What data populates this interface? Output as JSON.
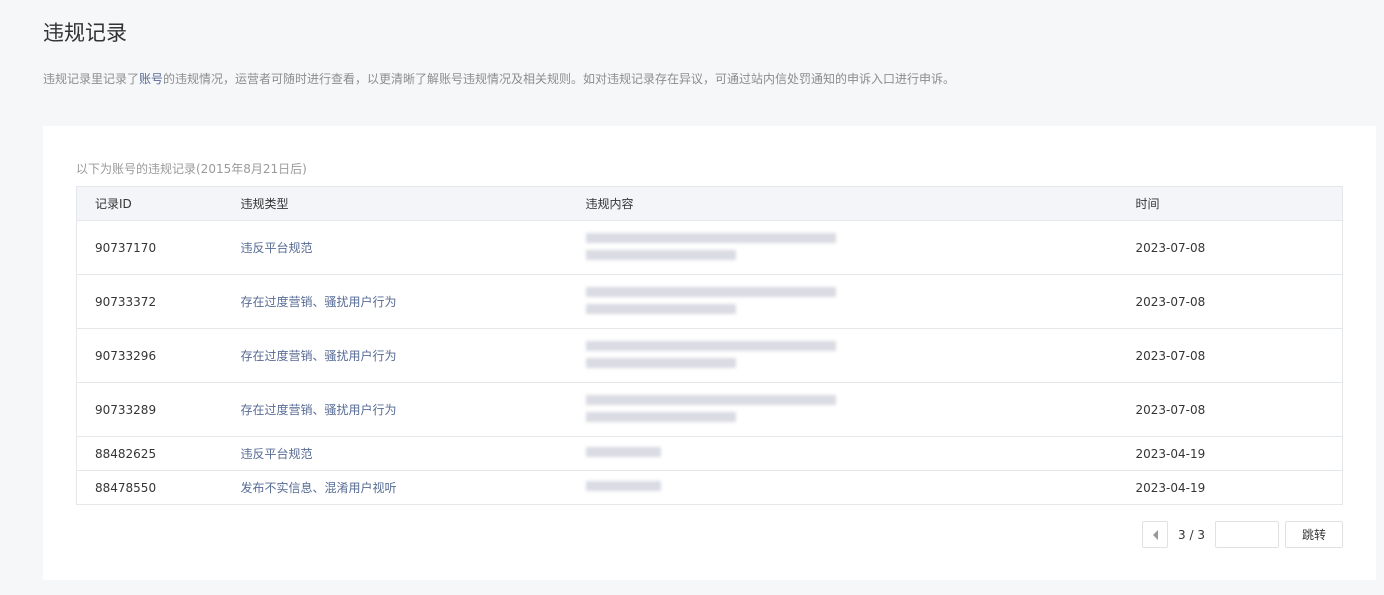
{
  "page": {
    "title": "违规记录",
    "description_before": "违规记录里记录了",
    "description_highlight": "账号",
    "description_after": "的违规情况，运营者可随时进行查看，以更清晰了解账号违规情况及相关规则。如对违规记录存在异议，可通过站内信处罚通知的申诉入口进行申诉。"
  },
  "records": {
    "subtitle": "以下为账号的违规记录(2015年8月21日后)",
    "headers": [
      "记录ID",
      "违规类型",
      "违规内容",
      "时间"
    ],
    "rows": [
      {
        "id": "90737170",
        "type": "违反平台规范",
        "time": "2023-07-08"
      },
      {
        "id": "90733372",
        "type": "存在过度营销、骚扰用户行为",
        "time": "2023-07-08"
      },
      {
        "id": "90733296",
        "type": "存在过度营销、骚扰用户行为",
        "time": "2023-07-08"
      },
      {
        "id": "90733289",
        "type": "存在过度营销、骚扰用户行为",
        "time": "2023-07-08"
      },
      {
        "id": "88482625",
        "type": "违反平台规范",
        "time": "2023-04-19"
      },
      {
        "id": "88478550",
        "type": "发布不实信息、混淆用户视听",
        "time": "2023-04-19"
      }
    ]
  },
  "pagination": {
    "current": "3 / 3",
    "input_value": "",
    "jump_label": "跳转"
  }
}
